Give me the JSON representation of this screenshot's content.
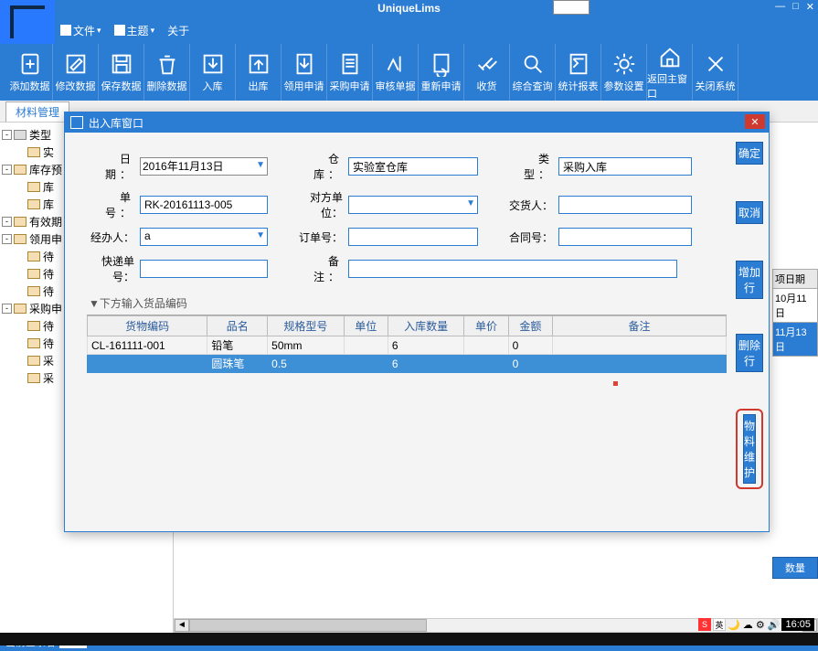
{
  "app": {
    "title": "UniqueLims"
  },
  "window_controls": {
    "min": "—",
    "max": "□",
    "close": "✕"
  },
  "menubar": [
    {
      "label": "文件"
    },
    {
      "label": "主题"
    },
    {
      "label": "关于"
    }
  ],
  "toolbar": [
    {
      "name": "add-data",
      "label": "添加数据"
    },
    {
      "name": "edit-data",
      "label": "修改数据"
    },
    {
      "name": "save-data",
      "label": "保存数据"
    },
    {
      "name": "delete-data",
      "label": "删除数据"
    },
    {
      "name": "in-store",
      "label": "入库"
    },
    {
      "name": "out-store",
      "label": "出库"
    },
    {
      "name": "receive-apply",
      "label": "领用申请"
    },
    {
      "name": "purchase-apply",
      "label": "采购申请"
    },
    {
      "name": "audit-single",
      "label": "审核单据"
    },
    {
      "name": "re-apply",
      "label": "重新申请"
    },
    {
      "name": "recall",
      "label": "收货"
    },
    {
      "name": "query",
      "label": "综合查询"
    },
    {
      "name": "report",
      "label": "统计报表"
    },
    {
      "name": "settings",
      "label": "参数设置"
    },
    {
      "name": "home",
      "label": "返回主窗口"
    },
    {
      "name": "close-system",
      "label": "关闭系统"
    }
  ],
  "tab": {
    "label": "材料管理"
  },
  "tree": [
    {
      "lvl": 0,
      "toggle": "-",
      "icon": "root",
      "label": "类型"
    },
    {
      "lvl": 1,
      "toggle": "",
      "label": "实"
    },
    {
      "lvl": 0,
      "toggle": "-",
      "label": "库存预"
    },
    {
      "lvl": 1,
      "toggle": "",
      "label": "库"
    },
    {
      "lvl": 1,
      "toggle": "",
      "label": "库"
    },
    {
      "lvl": 0,
      "toggle": "-",
      "label": "有效期"
    },
    {
      "lvl": 0,
      "toggle": "-",
      "label": "领用申"
    },
    {
      "lvl": 1,
      "toggle": "",
      "label": "待"
    },
    {
      "lvl": 1,
      "toggle": "",
      "label": "待"
    },
    {
      "lvl": 1,
      "toggle": "",
      "label": "待"
    },
    {
      "lvl": 0,
      "toggle": "-",
      "label": "采购申"
    },
    {
      "lvl": 1,
      "toggle": "",
      "label": "待"
    },
    {
      "lvl": 1,
      "toggle": "",
      "label": "待"
    },
    {
      "lvl": 1,
      "toggle": "",
      "label": "采"
    },
    {
      "lvl": 1,
      "toggle": "",
      "label": "采"
    }
  ],
  "peek": {
    "header": "项日期",
    "r1": "10月11日",
    "r2": "11月13日",
    "btn": "数量"
  },
  "modal": {
    "title": "出入库窗口",
    "labels": {
      "date": "日　期：",
      "no": "单　号：",
      "handler": "经办人：",
      "express": "快递单号：",
      "warehouse": "仓　库：",
      "other_unit": "对方单位：",
      "order_no": "订单号：",
      "remark": "备　注：",
      "type": "类　型：",
      "deliverer": "交货人：",
      "contract": "合同号："
    },
    "values": {
      "date": "2016年11月13日",
      "no": "RK-20161113-005",
      "handler": "a",
      "express": "",
      "warehouse": "实验室仓库",
      "other_unit": "",
      "order_no": "",
      "remark": "",
      "type": "采购入库",
      "deliverer": "",
      "contract": ""
    },
    "table_caption": "▼下方输入货品编码",
    "table_headers": [
      "货物编码",
      "品名",
      "规格型号",
      "单位",
      "入库数量",
      "单价",
      "金额",
      "备注"
    ],
    "table_rows": [
      {
        "code": "CL-161111-001",
        "name": "铅笔",
        "spec": "50mm",
        "unit": "",
        "qty": "6",
        "price": "",
        "amount": "0",
        "remark": ""
      },
      {
        "code": "",
        "name": "圆珠笔",
        "spec": "0.5",
        "unit": "",
        "qty": "6",
        "price": "",
        "amount": "0",
        "remark": ""
      }
    ],
    "buttons": {
      "ok": "确定",
      "cancel": "取消",
      "add_row": "增加行",
      "del_row": "删除行",
      "material_maint": "物料维护"
    }
  },
  "status": {
    "label": "当前登录者"
  },
  "clock": "16:05",
  "ime": "英"
}
